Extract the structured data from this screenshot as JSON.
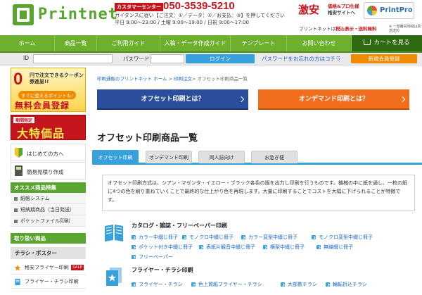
{
  "header": {
    "logo_text": "Printnet",
    "cs_badge": "カスタマーセンター",
    "cs_phone": "050-3539-5210",
    "cs_guide": "ガイダンスに従い【ご注文：①／データ：②／お支払：③】を押してください",
    "cs_hours": "平日 9:00～23:00 / 土曜 9:00～19:00 / 日祝 9:00～17:00",
    "promo_big": "激安",
    "promo_line1": "価格&プロ仕様",
    "promo_line2": "格安サイトへ",
    "printpro_label": "PrintPro",
    "tax_note_prefix": "プリントネットは",
    "tax_note_bold": "税込表示・送料無料",
    "tax_note_small": "※ 一部離島地域は別途送料"
  },
  "nav": {
    "items": [
      "ホーム",
      "商品一覧",
      "ご利用ガイド",
      "入稿・データ作成ガイド",
      "テンプレート",
      "お問い合わせ"
    ],
    "cart": "カートを見る"
  },
  "loginbar": {
    "id_label": "ID",
    "password_label": "パスワード",
    "login_button": "ログイン",
    "forgot_link": "パスワードをお忘れの方はコチラ",
    "register_button": "新規会員登録"
  },
  "sidebar": {
    "ad1": {
      "zero": "0",
      "line1": "円で注文できるクーポン券進呈!!",
      "tag": "すぐに使えるポイントも!",
      "big": "無料会員登録"
    },
    "ad2": {
      "badge": "期間限定",
      "big": "大特価品"
    },
    "beginner_link": "はじめての方へ",
    "estimate_link": "簡易見積り作成",
    "featured_head": "オススメ商品特集",
    "featured_items": [
      "紙帳システム",
      "短納期商品（当日発送）",
      "ポケットファイル印刷"
    ],
    "products_head": "取り扱い商品",
    "products_sub": "チラシ・ポスター",
    "products_items": [
      "格安フライヤー印刷",
      "フライヤー・チラシ印刷"
    ],
    "sale_badge": "SALE"
  },
  "main": {
    "breadcrumb_home": "印刷通販のプリントネット ホーム",
    "breadcrumb_sep": ">",
    "breadcrumb_mid": "印刷注文",
    "breadcrumb_current": "オフセット印刷商品一覧",
    "cta_offset": "オフセット印刷とは？",
    "cta_ondemand": "オンデマンド印刷とは？",
    "page_title": "オフセット印刷商品一覧",
    "tabs": [
      "オフセット印刷",
      "オンデマンド印刷",
      "同人誌向け",
      "お急ぎ便"
    ],
    "description": "オフセット印刷方式は、シアン・マゼンタ・イエロー・ブラック各色の版を出力し印刷を行うものです。機械の中に紙を通し、一枚の紙に4つの色を刷り重ねていくことで最終的な仕上がり色を再現します。大量に印刷することでコストを大幅に下げられることが特徴です。",
    "catalog": {
      "title": "カタログ・雑誌・フリーペーパー印刷",
      "links": [
        "カラー中綴じ冊子",
        "モノクロ中綴じ冊子",
        "カラー変型中綴じ冊子",
        "モノクロ変型中綴じ冊子",
        "ポケット付き中綴じ冊子",
        "表紙片観音中綴じ冊子",
        "横型中綴じ冊子",
        "無線綴じ冊子",
        "フリーペーパー"
      ]
    },
    "flyer": {
      "title": "フライヤー・チラシ印刷",
      "links": [
        "フライヤー・チラシ",
        "色上質紙フライヤー・チラシ",
        "大部数チラシ",
        "輪転折込チラシ"
      ]
    }
  },
  "colors": {
    "brand_green": "#6db02e",
    "nav_dark": "#2f6b12",
    "accent_blue": "#37a1dc",
    "cta_blue": "#2a4e9c",
    "cta_orange": "#f06e1e",
    "alert_red": "#c4161c"
  }
}
